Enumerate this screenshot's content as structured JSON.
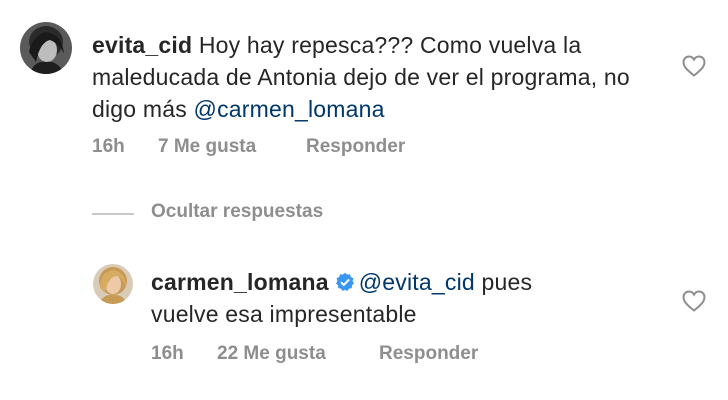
{
  "comment": {
    "username": "evita_cid",
    "text": "Hoy hay repesca??? Como vuelva la maleducada de Antonia dejo de ver el programa, no digo más",
    "mention": "@carmen_lomana",
    "time": "16h",
    "likes": "7 Me gusta",
    "reply_label": "Responder",
    "hide_replies_label": "Ocultar respuestas"
  },
  "reply": {
    "username": "carmen_lomana",
    "mention": "@evita_cid",
    "text_line1": "pues",
    "text_line2": "vuelve esa impresentable",
    "time": "16h",
    "likes": "22 Me gusta",
    "reply_label": "Responder",
    "verified_color": "#3897f0"
  },
  "colors": {
    "text": "#262626",
    "meta": "#8e8e8e",
    "mention": "#00376b"
  }
}
